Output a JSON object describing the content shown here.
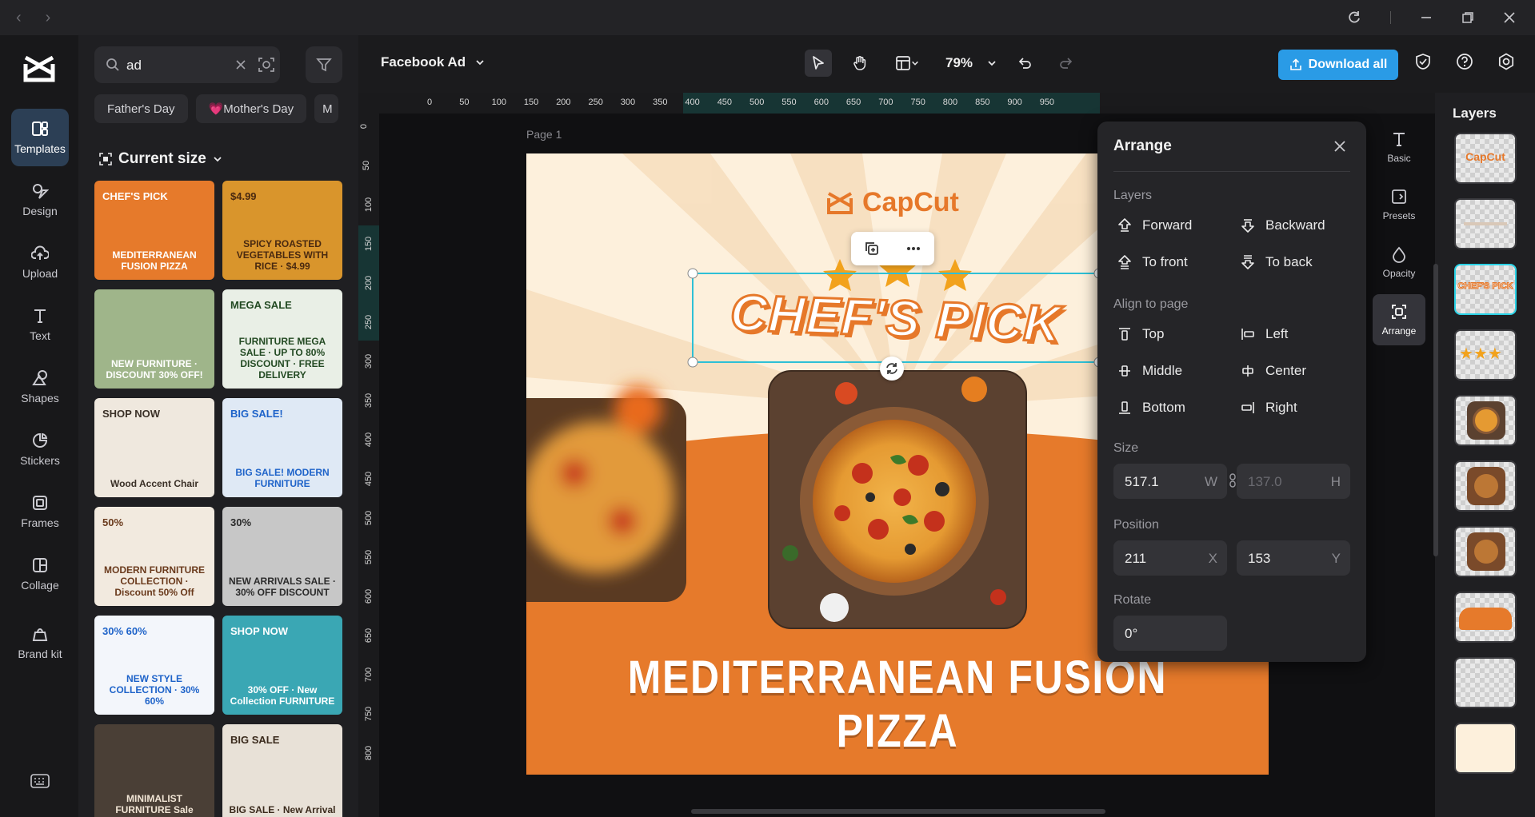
{
  "window": {
    "back_icon": "chevron-left-icon",
    "forward_icon": "chevron-right-icon"
  },
  "rail": {
    "items": [
      {
        "label": "Templates",
        "icon": "templates-icon",
        "active": true
      },
      {
        "label": "Design",
        "icon": "design-icon"
      },
      {
        "label": "Upload",
        "icon": "upload-icon"
      },
      {
        "label": "Text",
        "icon": "text-icon"
      },
      {
        "label": "Shapes",
        "icon": "shapes-icon"
      },
      {
        "label": "Stickers",
        "icon": "stickers-icon"
      },
      {
        "label": "Frames",
        "icon": "frames-icon"
      },
      {
        "label": "Collage",
        "icon": "collage-icon"
      },
      {
        "label": "Brand kit",
        "icon": "brand-kit-icon"
      }
    ]
  },
  "panel": {
    "search_value": "ad",
    "chips": [
      "Father's Day",
      "💗Mother's Day",
      "M"
    ],
    "size_filter": "Current size",
    "templates": [
      {
        "title": "MEDITERRANEAN FUSION PIZZA",
        "bg": "#e67a2b",
        "fg": "#ffffff",
        "badge": "CHEF'S PICK"
      },
      {
        "title": "SPICY ROASTED VEGETABLES WITH RICE · $4.99",
        "bg": "#d9952c",
        "fg": "#4a2a10",
        "badge": "$4.99"
      },
      {
        "title": "NEW FURNITURE · DISCOUNT 30% OFF!",
        "bg": "#9fb58a",
        "fg": "#ffffff",
        "badge": ""
      },
      {
        "title": "FURNITURE MEGA SALE · UP TO 80% DISCOUNT · FREE DELIVERY",
        "bg": "#e9efe6",
        "fg": "#234a23",
        "badge": "MEGA SALE"
      },
      {
        "title": "Wood Accent Chair",
        "bg": "#efe8de",
        "fg": "#3a3027",
        "badge": "SHOP NOW"
      },
      {
        "title": "BIG SALE! MODERN FURNITURE",
        "bg": "#dfe9f5",
        "fg": "#1e63c9",
        "badge": "BIG SALE!"
      },
      {
        "title": "MODERN FURNITURE COLLECTION · Discount 50% Off",
        "bg": "#f2eadf",
        "fg": "#6a3a1c",
        "badge": "50%"
      },
      {
        "title": "NEW ARRIVALS SALE · 30% OFF DISCOUNT",
        "bg": "#c7c7c7",
        "fg": "#2b2b2b",
        "badge": "30%"
      },
      {
        "title": "NEW STYLE COLLECTION · 30% 60%",
        "bg": "#f3f6fb",
        "fg": "#1e63c9",
        "badge": "30% 60%"
      },
      {
        "title": "30% OFF · New Collection FURNITURE",
        "bg": "#3aa7b4",
        "fg": "#ffffff",
        "badge": "SHOP NOW"
      },
      {
        "title": "MINIMALIST FURNITURE Sale",
        "bg": "#4a3f36",
        "fg": "#f2e6d6",
        "badge": ""
      },
      {
        "title": "BIG SALE · New Arrival",
        "bg": "#e8e1d7",
        "fg": "#3a2a1c",
        "badge": "BIG SALE"
      }
    ]
  },
  "toolbar": {
    "project_name": "Facebook Ad",
    "zoom": "79%",
    "download_label": "Download all",
    "accent": "#2a9be6"
  },
  "canvas": {
    "page_label": "Page 1",
    "brand_name": "CapCut",
    "headline": "CHEF'S PICK",
    "title": "MEDITERRANEAN FUSION PIZZA",
    "orange": "#e67a2b",
    "cream": "#fdf0dc",
    "ruler_h": [
      "0",
      "50",
      "100",
      "150",
      "200",
      "250",
      "300",
      "350",
      "400",
      "450",
      "500",
      "550",
      "600",
      "650",
      "700",
      "750",
      "800",
      "850",
      "900",
      "950"
    ],
    "ruler_v": [
      "0",
      "50",
      "100",
      "150",
      "200",
      "250",
      "300",
      "350",
      "400",
      "450",
      "500",
      "550",
      "600",
      "650",
      "700",
      "750",
      "800"
    ]
  },
  "arrange": {
    "title": "Arrange",
    "layers_label": "Layers",
    "forward": "Forward",
    "backward": "Backward",
    "to_front": "To front",
    "to_back": "To back",
    "align_label": "Align to page",
    "top": "Top",
    "left": "Left",
    "middle": "Middle",
    "center": "Center",
    "bottom": "Bottom",
    "right": "Right",
    "size_label": "Size",
    "width": "517.1",
    "width_unit": "W",
    "height": "137.0",
    "height_unit": "H",
    "position_label": "Position",
    "x": "211",
    "x_unit": "X",
    "y": "153",
    "y_unit": "Y",
    "rotate_label": "Rotate",
    "rotate": "0°"
  },
  "ptabs": [
    {
      "label": "Basic",
      "icon": "text-basic-icon"
    },
    {
      "label": "Presets",
      "icon": "presets-icon"
    },
    {
      "label": "Opacity",
      "icon": "opacity-icon"
    },
    {
      "label": "Arrange",
      "icon": "arrange-icon",
      "active": true
    }
  ],
  "layers": {
    "title": "Layers",
    "items": [
      {
        "label": "CapCut",
        "kind": "logo"
      },
      {
        "label": "",
        "kind": "text-faint"
      },
      {
        "label": "CHEF'S PICK",
        "kind": "headline",
        "selected": true
      },
      {
        "label": "",
        "kind": "stars"
      },
      {
        "label": "",
        "kind": "pizza"
      },
      {
        "label": "",
        "kind": "pizza-blur"
      },
      {
        "label": "",
        "kind": "pizza-blur"
      },
      {
        "label": "",
        "kind": "orange-shape"
      },
      {
        "label": "",
        "kind": "empty"
      },
      {
        "label": "",
        "kind": "background"
      }
    ]
  }
}
